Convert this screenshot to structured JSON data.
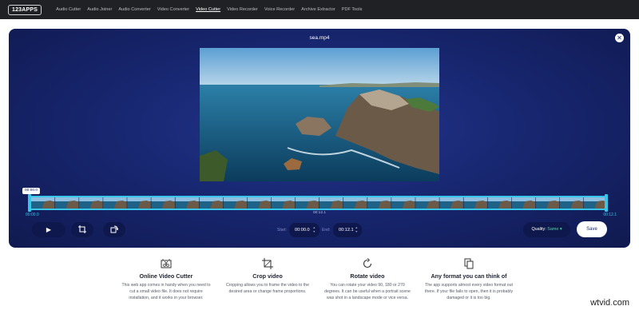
{
  "nav": {
    "logo": "123APPS",
    "links": [
      "Audio Cutter",
      "Audio Joiner",
      "Audio Converter",
      "Video Converter",
      "Video Cutter",
      "Video Recorder",
      "Voice Recorder",
      "Archive Extractor",
      "PDF Tools"
    ],
    "active_index": 4
  },
  "editor": {
    "filename": "sea.mp4",
    "close_icon": "close-icon",
    "timeline": {
      "playhead_time": "00:00.0",
      "start_label": "00:00.0",
      "mid_label": "00:12.1",
      "end_label": "00:12.1",
      "frame_count": 24
    },
    "controls": {
      "play_icon": "play-icon",
      "crop_icon": "crop-icon",
      "rotate_icon": "rotate-icon",
      "start_label": "Start:",
      "start_value": "00:00.0",
      "end_label": "End:",
      "end_value": "00:12.1",
      "quality_label": "Quality:",
      "quality_value": "Same",
      "save_label": "Save"
    }
  },
  "features": [
    {
      "icon": "video-cut-icon",
      "title": "Online Video Cutter",
      "desc": "This web app comes in handy when you need to cut a small video file. It does not require installation, and it works in your browser."
    },
    {
      "icon": "crop-icon",
      "title": "Crop video",
      "desc": "Cropping allows you to frame the video to the desired area or change frame proportions."
    },
    {
      "icon": "rotate-icon",
      "title": "Rotate video",
      "desc": "You can rotate your video 90, 180 or 270 degrees. It can be useful when a portrait scene was shot in a landscape mode or vice versa."
    },
    {
      "icon": "copy-files-icon",
      "title": "Any format you can think of",
      "desc": "The app supports almost every video format out there. If your file fails to open, then it is probably damaged or it is too big."
    }
  ],
  "watermark": {
    "text": "wtvid.com",
    "main": "wtvid",
    "accent": ".",
    "suffix": "com"
  },
  "colors": {
    "panel": "#16246b",
    "accent": "#39c4e9",
    "quality": "#4fd3a1",
    "nav": "#202124"
  }
}
